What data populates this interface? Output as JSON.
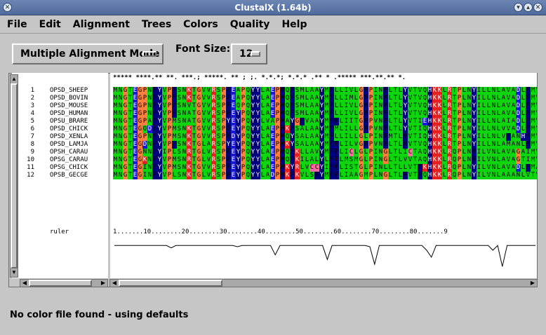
{
  "window": {
    "title": "ClustalX (1.64b)"
  },
  "menubar": [
    "File",
    "Edit",
    "Alignment",
    "Trees",
    "Colors",
    "Quality",
    "Help"
  ],
  "mode": {
    "selected": "Multiple Alignment Mode"
  },
  "font_size": {
    "label": "Font Size:",
    "value": "12"
  },
  "consensus": "*****  ****.** **. ***.; *****. ** ;  ;. *.*.*; *.*.* .** * .***** ***.**.** *.",
  "names": [
    {
      "idx": "1",
      "name": "OPSD_SHEEP"
    },
    {
      "idx": "2",
      "name": "OPSD_BOVIN"
    },
    {
      "idx": "3",
      "name": "OPSD_MOUSE"
    },
    {
      "idx": "4",
      "name": "OPSD_HUMAN"
    },
    {
      "idx": "5",
      "name": "OPSU_BRARE"
    },
    {
      "idx": "6",
      "name": "OPSD_CHICK"
    },
    {
      "idx": "7",
      "name": "OPSD_XENLA"
    },
    {
      "idx": "8",
      "name": "OPSD_LAMJA"
    },
    {
      "idx": "9",
      "name": "OPSH_CARAU"
    },
    {
      "idx": "10",
      "name": "OPSG_CARAU"
    },
    {
      "idx": "11",
      "name": "OPSG_CHICK"
    },
    {
      "idx": "12",
      "name": "OPSB_GECGE"
    }
  ],
  "sequences": [
    "MNGTEGPNFYVPFSNKTGVVRSPFEAPQYYLAEPWQFSMLAAYMFLLIVLGFPINFLTLYVTVQHKKLRTPLNYILLNLAVADLFMVFG",
    "MNGTEGPNFYVPFSNKTGVVRSPFEAPQYYLAEPWQFSMLAAYMFLLIMLGFPINFLTLYVTVQHKKLRTPLNYILLNLAVADLFMVFG",
    "MNGTEGPNFYVPFSNVTGVVRSPFEQPQYYLAEPWQFSMLAAYMFLLIVLGFPINFLTLYVTVQHKKLRTPLNYILLNLAVADLFMVFG",
    "MNGTEGPNFYVPFSNATGVVRSPFEYPQYYLAEPWQFSMLAAYMFLLIVLGFPINFLTLYVTVQHKKLRTPLNYILLNLAVADLFMVLG",
    "MNGTEGPAFYVPMSNATGVVRSPYEYPQYYLVAPWAYGFVAAYMFFLIITGFPVNFLTLYVTIEHKKLRTPLNYILLNLAIADLFMVFG",
    "MNGTEGQDFYVPMSNKTGVVRSPFEYPQYYLAEPWKFSALAAYMFMLILLGFPVNFLTLYVTIQHKKLRTPLNYILLNLVVADLFMVFG",
    "MNGTEGPNFYVPMSNKTGVVRSPFDYPQYYLAEPWQYSALAAYMFLLILLGLPINFMTLFVTIQHKKLRTPLNYILLNLVFANHFMVLC",
    "MNGTEGDNFYVPFSNKTGLARSPYEYPQYYLAEPWKYSALAAYMFFLILVGFPVNFLTLFVTVQHKKLRTPLNYILLNLAMANLFMVLF",
    "MNGTEGNNFYIPLSNRTGLVRSPFEYPQYYLAEPWQFKLLAVYMFFLICLGLPINGLTLICTAQHKKLRQPLNFILVNLAVAGAIMVCF",
    "MNGTEGKNFYVPMSNRTGLVRSPFEYPQYYLAEPWQFKILALYLFFLMSMGLPINGLTLVVTAQHKKLRQPLNFILVNLAVAGTIMVCF",
    "MNGTEGINFYVPMSNKTGVVRSPFEYPQYYLAEPWKYRLVCCYIFFLISTGLPINLLTLLVTFKHKKLRQPLNYILVNLAVADLFMACF",
    "MNGTEGINFYVPLSNKTGLVRSPFEYPQYYLADPWKFKVLSFYMFFLIAAGMPLNGLTLFVTFQHKKLRQPLNYILVNLAAANLVTVCC"
  ],
  "ruler": {
    "label": "ruler",
    "text": "1.......10........20........30........40........50........60........70........80.......9"
  },
  "quality_curve": [
    28,
    28,
    28,
    28,
    28,
    28,
    28,
    28,
    28,
    28,
    28,
    28,
    26,
    28,
    28,
    28,
    28,
    28,
    28,
    28,
    28,
    28,
    28,
    28,
    28,
    28,
    27,
    28,
    28,
    28,
    28,
    28,
    28,
    28,
    20,
    28,
    28,
    28,
    28,
    28,
    28,
    28,
    28,
    28,
    28,
    16,
    28,
    28,
    28,
    28,
    28,
    28,
    28,
    28,
    27,
    12,
    28,
    28,
    28,
    28,
    28,
    28,
    28,
    28,
    28,
    28,
    24,
    18,
    28,
    28,
    28,
    28,
    28,
    28,
    28,
    28,
    28,
    28,
    28,
    28,
    24,
    28,
    10,
    28,
    28,
    28,
    28,
    28,
    28,
    28
  ],
  "status": "No color file found - using defaults",
  "colors": {
    "hydrophobic": "#1c9a1c",
    "acid": "#e62020",
    "basic": "#1818d6",
    "polar": "#0fd50f",
    "special": "#ff8040",
    "cys": "#ff6aa0",
    "aromatic": "#00007d"
  }
}
